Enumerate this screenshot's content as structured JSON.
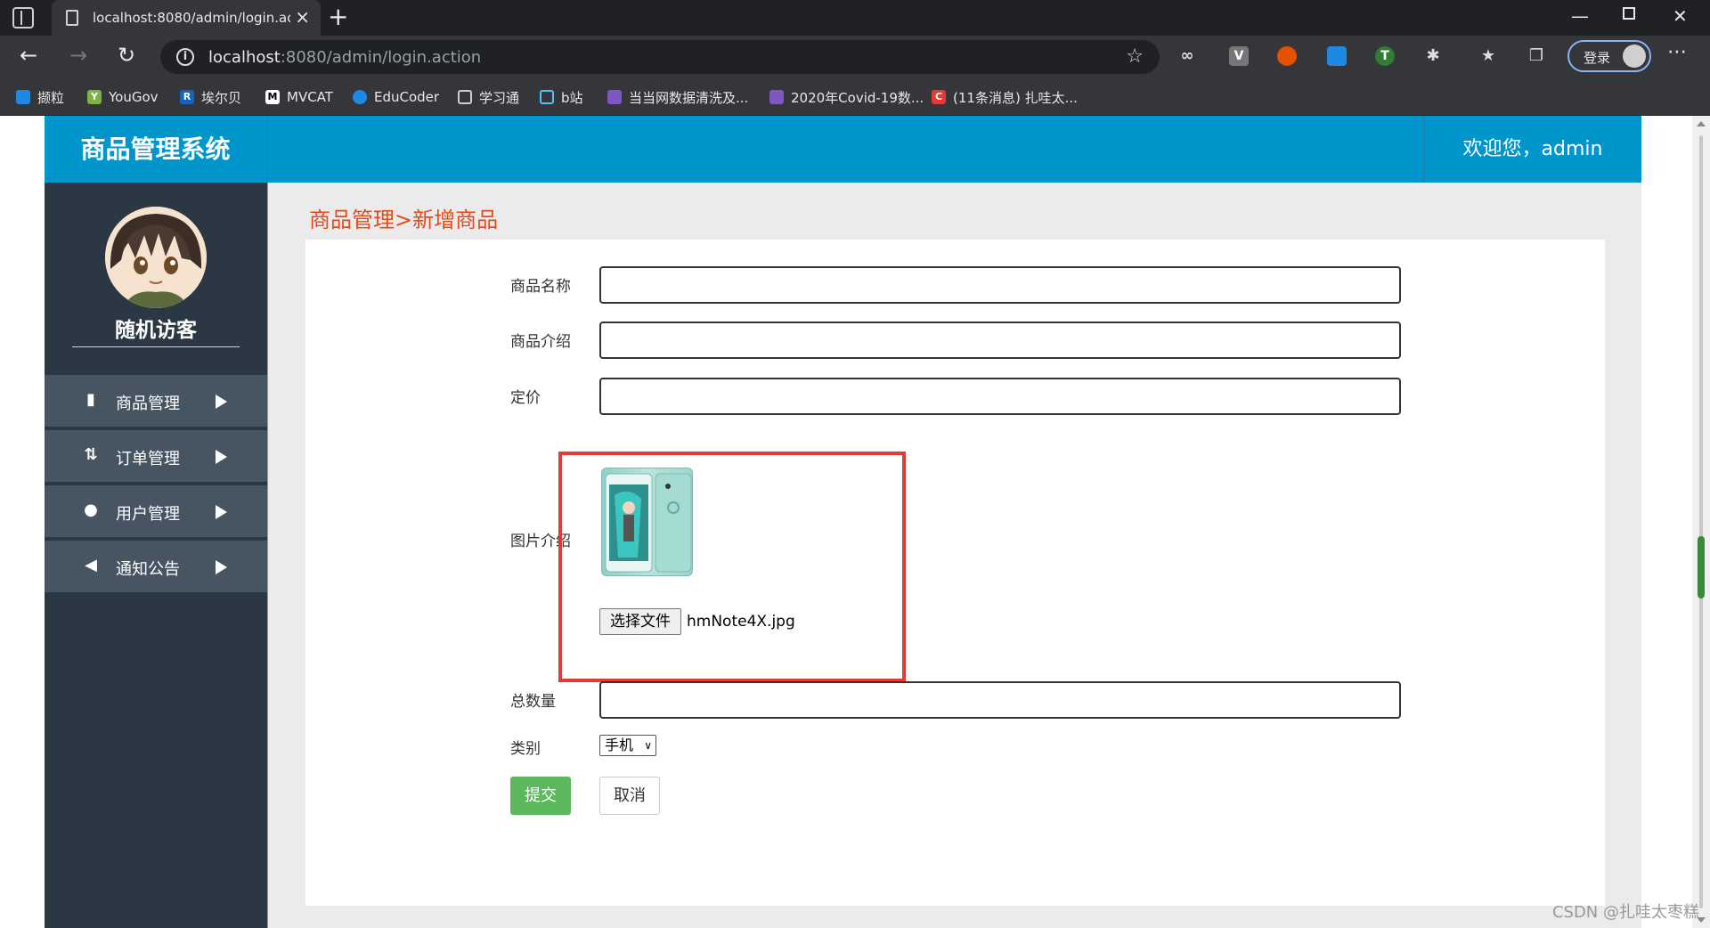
{
  "browser": {
    "tab_title": "localhost:8080/admin/login.action",
    "tab_close": "×",
    "new_tab": "+",
    "url_host": "localhost",
    "url_path": ":8080/admin/login.action",
    "login_label": "登录",
    "bookmarks": [
      {
        "label": "撷粒",
        "icon_color": "#1e88e5"
      },
      {
        "label": "YouGov",
        "icon_color": "#7cb342"
      },
      {
        "label": "埃尔贝",
        "icon_color": "#1565c0"
      },
      {
        "label": "MVCAT",
        "icon_color": "#ffffff"
      },
      {
        "label": "EduCoder",
        "icon_color": "#1e88e5"
      },
      {
        "label": "学习通",
        "icon_color": "#cfcfcf"
      },
      {
        "label": "b站",
        "icon_color": "#4fc3f7"
      },
      {
        "label": "当当网数据清洗及...",
        "icon_color": "#7e57c2"
      },
      {
        "label": "2020年Covid-19数...",
        "icon_color": "#7e57c2"
      },
      {
        "label": "(11条消息) 扎哇太...",
        "icon_color": "#e53935"
      }
    ]
  },
  "header": {
    "brand": "商品管理系统",
    "welcome": "欢迎您，admin"
  },
  "sidebar": {
    "user_name": "随机访客",
    "items": [
      {
        "label": "商品管理",
        "icon": "book-icon"
      },
      {
        "label": "订单管理",
        "icon": "sort-arrows-icon"
      },
      {
        "label": "用户管理",
        "icon": "user-icon"
      },
      {
        "label": "通知公告",
        "icon": "bullhorn-icon"
      }
    ]
  },
  "content": {
    "breadcrumb": "商品管理>新增商品",
    "form": {
      "name_label": "商品名称",
      "intro_label": "商品介绍",
      "price_label": "定价",
      "image_label": "图片介绍",
      "choose_file": "选择文件",
      "file_name": "hmNote4X.jpg",
      "quantity_label": "总数量",
      "category_label": "类别",
      "category_value": "手机",
      "submit": "提交",
      "cancel": "取消"
    }
  },
  "watermark": "CSDN @扎哇太枣糕",
  "colors": {
    "header_blue": "#0096cb",
    "sidebar_bg": "#2b3742",
    "menu_bg": "#475462",
    "breadcrumb": "#e64a19",
    "submit_green": "#5cb85c",
    "highlight_red": "#e53935"
  }
}
